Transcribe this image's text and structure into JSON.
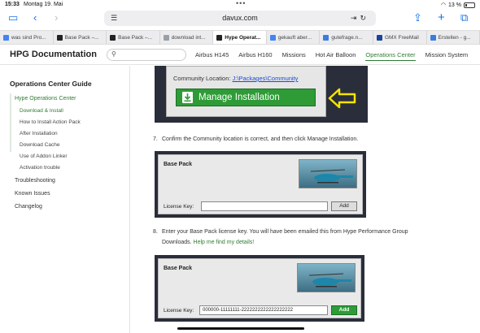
{
  "status": {
    "time": "15:33",
    "date": "Montag 19. Mai",
    "battery": "13 %"
  },
  "browser": {
    "url": "davux.com"
  },
  "tabs": [
    {
      "label": "was sind Pro...",
      "color": "#4285f4"
    },
    {
      "label": "Base Pack –...",
      "color": "#222222"
    },
    {
      "label": "Base Pack –...",
      "color": "#222222"
    },
    {
      "label": "download int...",
      "color": "#9aa0a6"
    },
    {
      "label": "Hype Operat...",
      "color": "#222222",
      "active": true
    },
    {
      "label": "gekauft aber...",
      "color": "#4285f4"
    },
    {
      "label": "gutefrage.n...",
      "color": "#3b7ddd"
    },
    {
      "label": "GMX FreeMail",
      "color": "#1c449b"
    },
    {
      "label": "Erstellen - g...",
      "color": "#3b7ddd"
    }
  ],
  "site": {
    "brand": "HPG Documentation",
    "nav": [
      "Airbus H145",
      "Airbus H160",
      "Missions",
      "Hot Air Balloon",
      "Operations Center",
      "Mission System"
    ],
    "nav_active_index": 4
  },
  "sidebar": {
    "title": "Operations Center Guide",
    "items": [
      "Hype Operations Center",
      "Download & Install",
      "How to Install Action Pack",
      "After Installation",
      "Download Cache",
      "Use of Addon Linker",
      "Activation trouble",
      "Troubleshooting",
      "Known Issues",
      "Changelog"
    ]
  },
  "content": {
    "shot1": {
      "location_label": "Community Location:",
      "location_path": "J:\\Packages\\Community",
      "button": "Manage Installation"
    },
    "step7": {
      "num": "7.",
      "text": "Confirm the Community location is correct, and then click Manage Installation."
    },
    "shot2": {
      "title": "Base Pack",
      "key_label": "License Key:",
      "key_value": "",
      "add": "Add"
    },
    "step8": {
      "num": "8.",
      "text1": "Enter your Base Pack license key. You will have been emailed this from Hype Performance Group",
      "text2": "Downloads.",
      "link": "Help me find my details!"
    },
    "shot3": {
      "title": "Base Pack",
      "key_label": "License Key:",
      "key_value": "000000-11111111-2222222222222222222",
      "add": "Add"
    }
  },
  "colors": {
    "accent": "#2e7d32",
    "link": "#1a73e8",
    "manage_button": "#2e9b37",
    "arrow": "#f3e500"
  }
}
